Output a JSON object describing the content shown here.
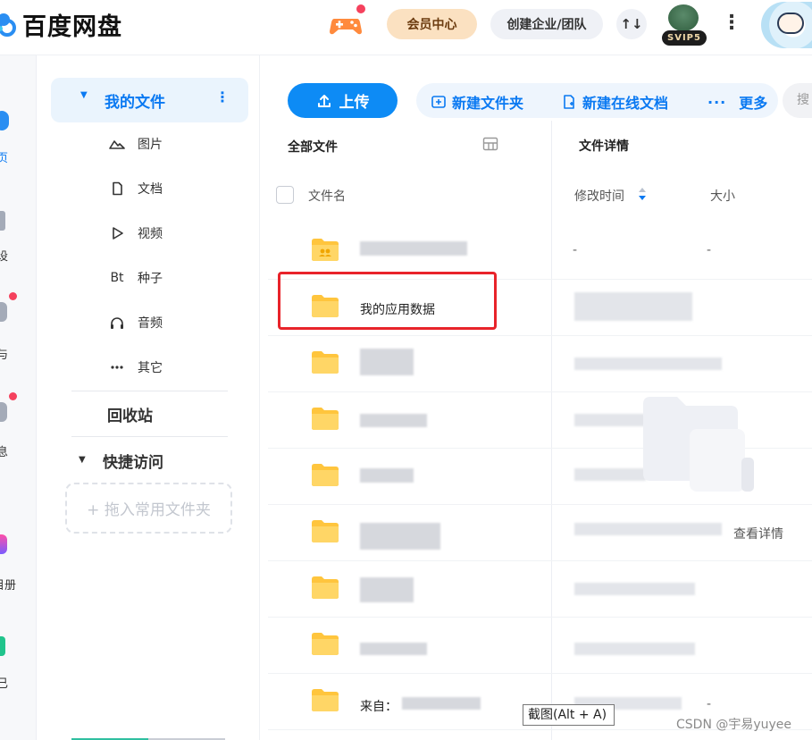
{
  "header": {
    "app_name": "百度网盘",
    "vip_center_label": "会员中心",
    "team_label": "创建企业/团队",
    "transfer_label": "↑↓",
    "svip_badge": "SVIP5",
    "more_label": "⋮",
    "icons": [
      "baidu-netdisk-logo-icon",
      "game-controller-icon",
      "transfer-icon",
      "svip-avatar-icon",
      "more-menu-icon",
      "user-avatar-icon"
    ]
  },
  "appnav": {
    "fragments": [
      "页",
      "设",
      "与",
      "息",
      "目册",
      "已"
    ]
  },
  "sidebar": {
    "my_files": "我的文件",
    "categories": [
      {
        "label": "图片",
        "icon": "image-icon"
      },
      {
        "label": "文档",
        "icon": "document-icon"
      },
      {
        "label": "视频",
        "icon": "video-icon"
      },
      {
        "label": "种子",
        "icon": "torrent-icon",
        "glyph": "Bt"
      },
      {
        "label": "音频",
        "icon": "audio-icon"
      },
      {
        "label": "其它",
        "icon": "other-icon"
      }
    ],
    "recycle_bin": "回收站",
    "quick_access": "快捷访问",
    "drop_folder_hint": "+ 拖入常用文件夹"
  },
  "toolbar": {
    "upload_label": "上传",
    "new_folder_label": "新建文件夹",
    "new_doc_label": "新建在线文档",
    "more_label": "更多",
    "search_placeholder": "搜"
  },
  "file_list": {
    "breadcrumb": "全部文件",
    "columns": {
      "name": "文件名",
      "mtime": "修改时间",
      "size": "大小"
    },
    "rows": [
      {
        "name": "",
        "mtime": "-",
        "size": "-",
        "shared": true
      },
      {
        "name": "我的应用数据",
        "mtime": "",
        "size": ""
      },
      {
        "name": "",
        "mtime": "",
        "size": ""
      },
      {
        "name": "",
        "mtime": "",
        "size": ""
      },
      {
        "name": "",
        "mtime": "",
        "size": ""
      },
      {
        "name": "",
        "mtime": "",
        "size": ""
      },
      {
        "name": "",
        "mtime": "",
        "size": ""
      },
      {
        "name": "",
        "mtime": "",
        "size": ""
      },
      {
        "name": "来自：",
        "mtime": "",
        "size": "-"
      }
    ]
  },
  "details": {
    "title": "文件详情",
    "view_detail_label": "查看详情"
  },
  "overlay": {
    "screenshot_tooltip": "截图(Alt + A)",
    "watermark": "CSDN @宇易yuyee"
  },
  "colors": {
    "accent": "#0d8bf5",
    "folder": "#ffc53d",
    "highlight": "#e8232a"
  }
}
